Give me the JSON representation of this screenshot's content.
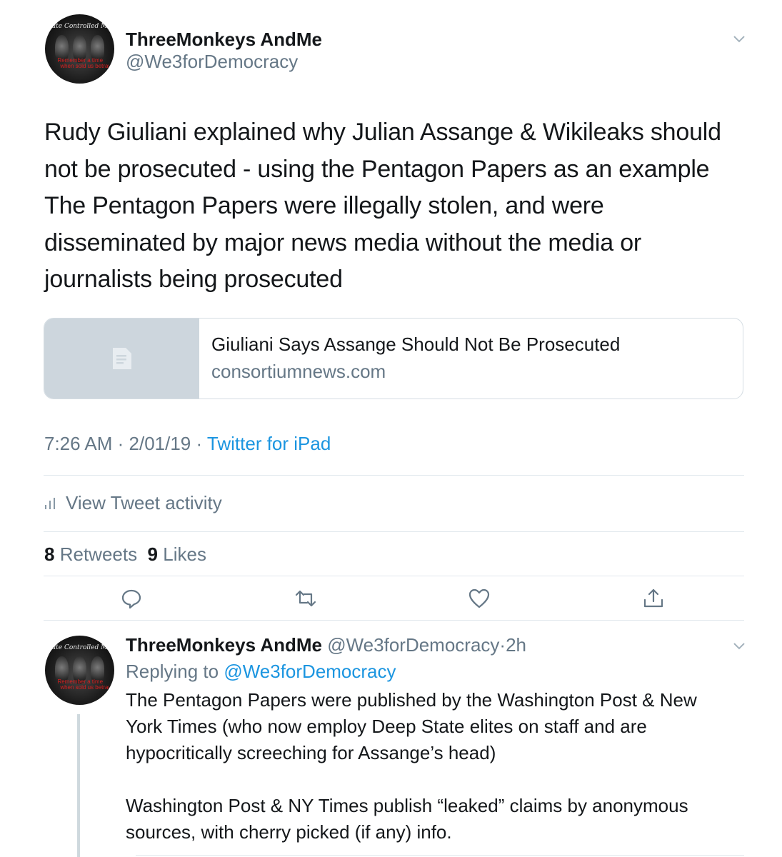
{
  "tweet": {
    "author_name": "ThreeMonkeys AndMe",
    "author_handle": "@We3forDemocracy",
    "avatar_banner": "State Controlled Media",
    "avatar_red_line1": "Remember a time",
    "avatar_red_line2": "when sold us betrayal",
    "text_lines": [
      "Rudy Giuliani explained why Julian Assange & Wikileaks should",
      "not be prosecuted - using the Pentagon Papers as an example",
      "The Pentagon Papers were illegally stolen, and were",
      "disseminated by major news media without the media or",
      "journalists being prosecuted"
    ],
    "card": {
      "title": "Giuliani Says Assange Should Not Be Prosecuted",
      "domain": "consortiumnews.com",
      "thumb_icon": "document-icon"
    },
    "time": "7:26 AM",
    "date": "2/01/19",
    "separator": " · ",
    "source": "Twitter for iPad",
    "activity_label": "View Tweet activity",
    "retweets_count": "8",
    "retweets_label": "Retweets",
    "likes_count": "9",
    "likes_label": "Likes",
    "actions": [
      "reply-icon",
      "retweet-icon",
      "like-icon",
      "share-icon"
    ]
  },
  "reply": {
    "author_name": "ThreeMonkeys AndMe",
    "author_handle": "@We3forDemocracy",
    "age": "2h",
    "replying_to_label": "Replying to",
    "replying_to_handle": "@We3forDemocracy",
    "para1_lines": [
      "The Pentagon Papers were published by the Washington Post & New",
      "York Times (who now employ Deep State elites on staff and are",
      "hypocritically screeching for Assange’s head)"
    ],
    "para2_lines": [
      "Washington Post & NY Times publish “leaked” claims by anonymous",
      "sources, with cherry picked (if any) info."
    ]
  },
  "colors": {
    "text": "#14171a",
    "secondary": "#657786",
    "link": "#1b95e0",
    "divider": "#e1e8ed"
  }
}
